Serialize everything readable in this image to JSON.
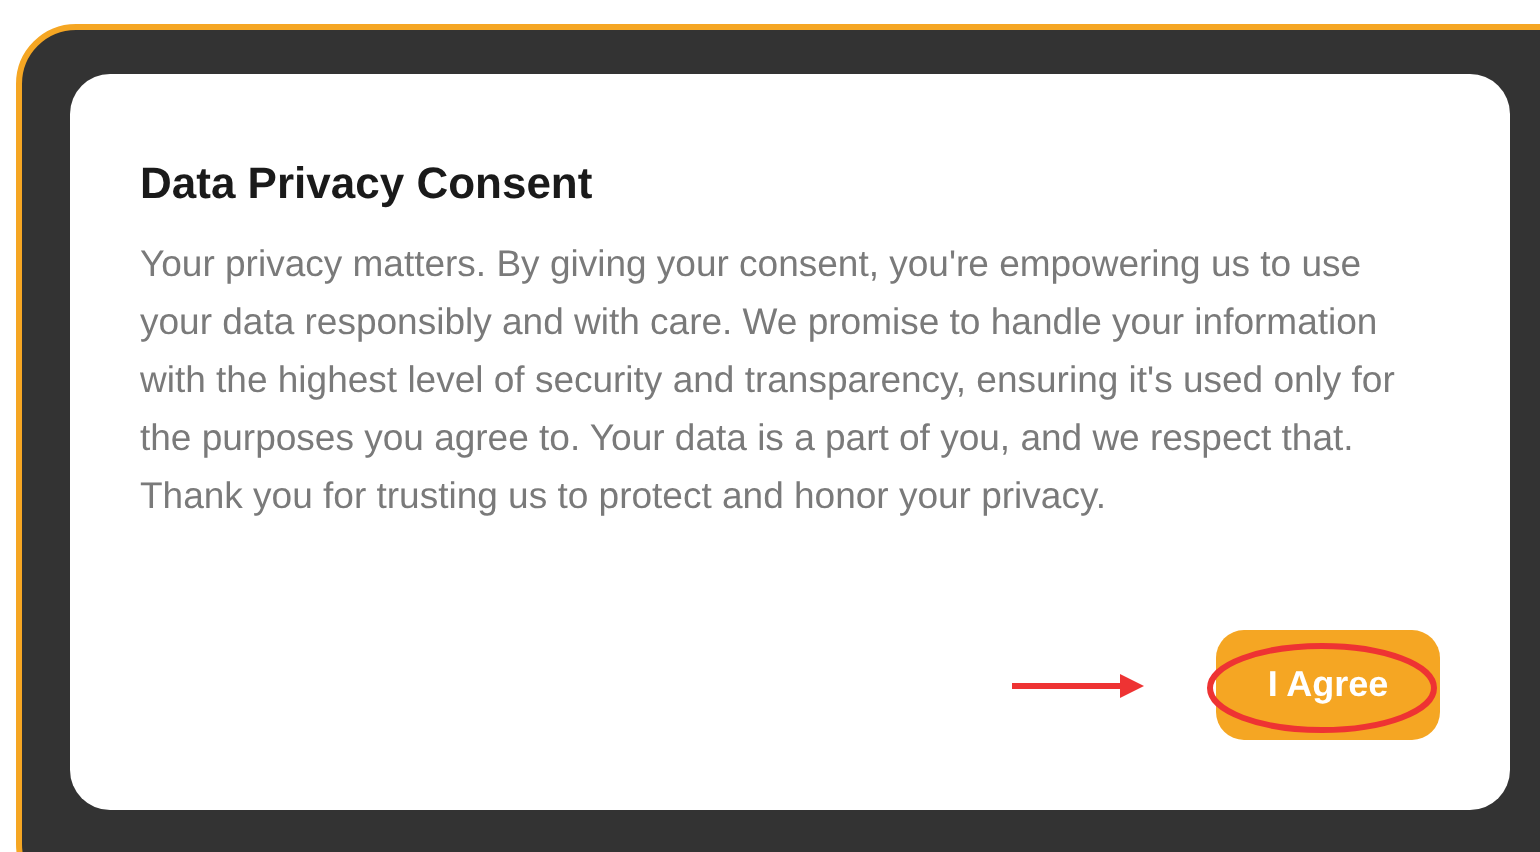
{
  "dialog": {
    "title": "Data Privacy Consent",
    "body": "Your privacy matters. By giving your consent, you're empowering us to use your data responsibly and with care. We promise to handle your information with the highest level of security and transparency, ensuring it's used only for the purposes you agree to. Your data is a part of you, and we respect that. Thank you for trusting us to protect and honor your privacy.",
    "button": "I Agree"
  }
}
